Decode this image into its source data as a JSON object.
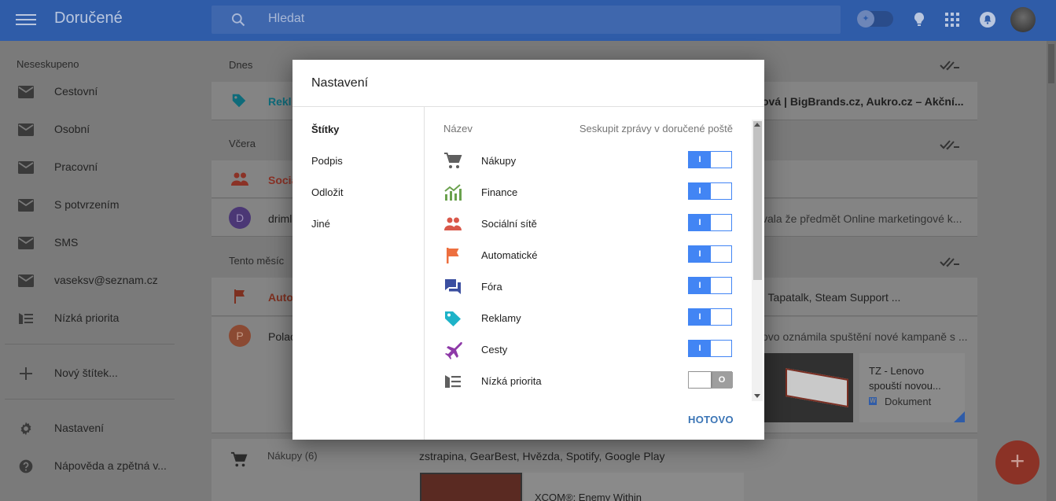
{
  "app": {
    "title": "Doručené",
    "search_placeholder": "Hledat"
  },
  "sidebar": {
    "section": "Neseskupeno",
    "items": [
      {
        "label": "Cestovní",
        "icon": "mail-icon"
      },
      {
        "label": "Osobní",
        "icon": "mail-icon"
      },
      {
        "label": "Pracovní",
        "icon": "mail-icon"
      },
      {
        "label": "S potvrzením",
        "icon": "mail-icon"
      },
      {
        "label": "SMS",
        "icon": "mail-icon"
      },
      {
        "label": "vaseksv@seznam.cz",
        "icon": "mail-icon"
      },
      {
        "label": "Nízká priorita",
        "icon": "low-priority-icon"
      }
    ],
    "new_label": "Nový štítek...",
    "settings": "Nastavení",
    "help": "Nápověda a zpětná v..."
  },
  "list": {
    "today": "Dnes",
    "yesterday": "Včera",
    "this_month": "Tento měsíc",
    "row1_label": "Rekl",
    "row1_text": "ová | BigBrands.cz, Aukro.cz – Akční...",
    "row2_label": "Socia",
    "row3_avatar": "D",
    "row3_sender": "driml",
    "row3_text": "vala že předmět Online marketingové k...",
    "row4_label": "Auto",
    "row4_text": ", Tapatalk, Steam Support ...",
    "row5_avatar": "P",
    "row5_sender": "Polac",
    "row5_text": "ovo oznámila spuštění nové kampaně s ...",
    "doc_title": "TZ - Lenovo spouští novou...",
    "doc_type": "Dokument",
    "shopping_label": "Nákupy (6)",
    "shopping_senders": "zstrapina, GearBest, Hvězda, Spotify, Google Play",
    "shopping_preview": "XCOM®: Enemy Within"
  },
  "modal": {
    "title": "Nastavení",
    "nav": [
      "Štítky",
      "Podpis",
      "Odložit",
      "Jiné"
    ],
    "col_name": "Název",
    "col_group": "Seskupit zprávy v doručené poště",
    "on_label": "I",
    "off_label": "O",
    "rows": [
      {
        "label": "Nákupy",
        "icon": "shopping-cart-icon",
        "color": "#5f5f5f",
        "on": true
      },
      {
        "label": "Finance",
        "icon": "finance-chart-icon",
        "color": "#6aa14d",
        "on": true
      },
      {
        "label": "Sociální sítě",
        "icon": "people-icon",
        "color": "#d9584a",
        "on": true
      },
      {
        "label": "Automatické",
        "icon": "flag-icon",
        "color": "#ed6f3f",
        "on": true
      },
      {
        "label": "Fóra",
        "icon": "forum-icon",
        "color": "#3b4fa0",
        "on": true
      },
      {
        "label": "Reklamy",
        "icon": "tag-icon",
        "color": "#1eb3c8",
        "on": true
      },
      {
        "label": "Cesty",
        "icon": "airplane-icon",
        "color": "#8e3aa8",
        "on": true
      },
      {
        "label": "Nízká priorita",
        "icon": "low-priority-icon",
        "color": "#5f5f5f",
        "on": false
      }
    ],
    "done": "HOTOVO"
  }
}
